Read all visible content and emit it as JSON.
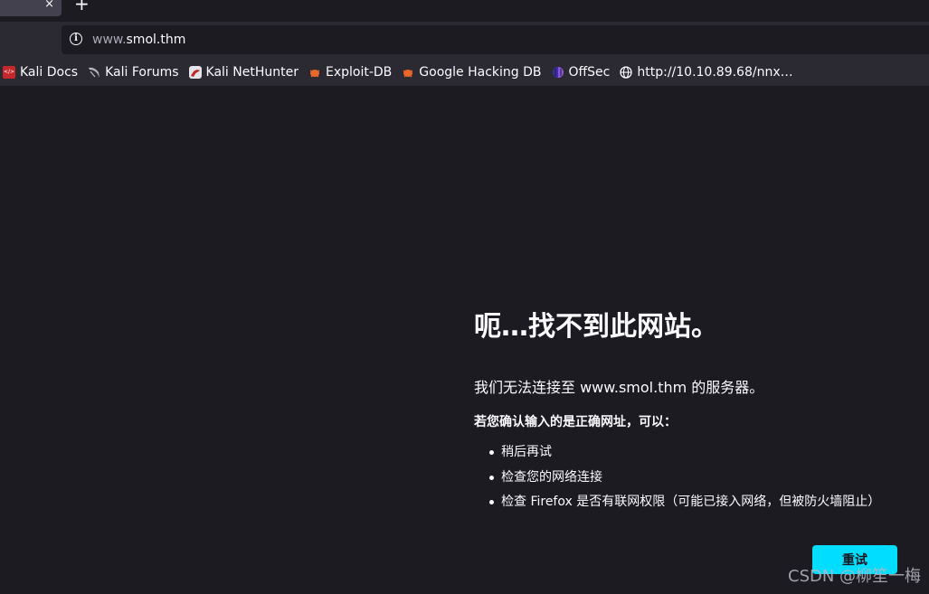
{
  "tab": {
    "close_icon": "×",
    "new_tab_icon": "+"
  },
  "urlbar": {
    "prefix": "www.",
    "domain": "smol.thm",
    "info_icon": "i"
  },
  "bookmarks": [
    {
      "label": "Kali Docs",
      "icon": "kali-docs-icon"
    },
    {
      "label": "Kali Forums",
      "icon": "kali-dragon-icon"
    },
    {
      "label": "Kali NetHunter",
      "icon": "nethunter-icon"
    },
    {
      "label": "Exploit-DB",
      "icon": "exploit-db-icon"
    },
    {
      "label": "Google Hacking DB",
      "icon": "ghdb-icon"
    },
    {
      "label": "OffSec",
      "icon": "offsec-icon"
    },
    {
      "label": "http://10.10.89.68/nnx…",
      "icon": "globe-icon"
    }
  ],
  "error": {
    "title": "呃…找不到此网站。",
    "message": "我们无法连接至 www.smol.thm 的服务器。",
    "question": "若您确认输入的是正确网址，可以：",
    "suggestions": [
      "稍后再试",
      "检查您的网络连接",
      "检查 Firefox 是否有联网权限（可能已接入网络，但被防火墙阻止）"
    ],
    "retry_label": "重试"
  },
  "watermark": "CSDN @柳笙一梅",
  "colors": {
    "accent": "#00ddff",
    "background": "#1c1b22",
    "toolbar": "#2b2a33"
  }
}
